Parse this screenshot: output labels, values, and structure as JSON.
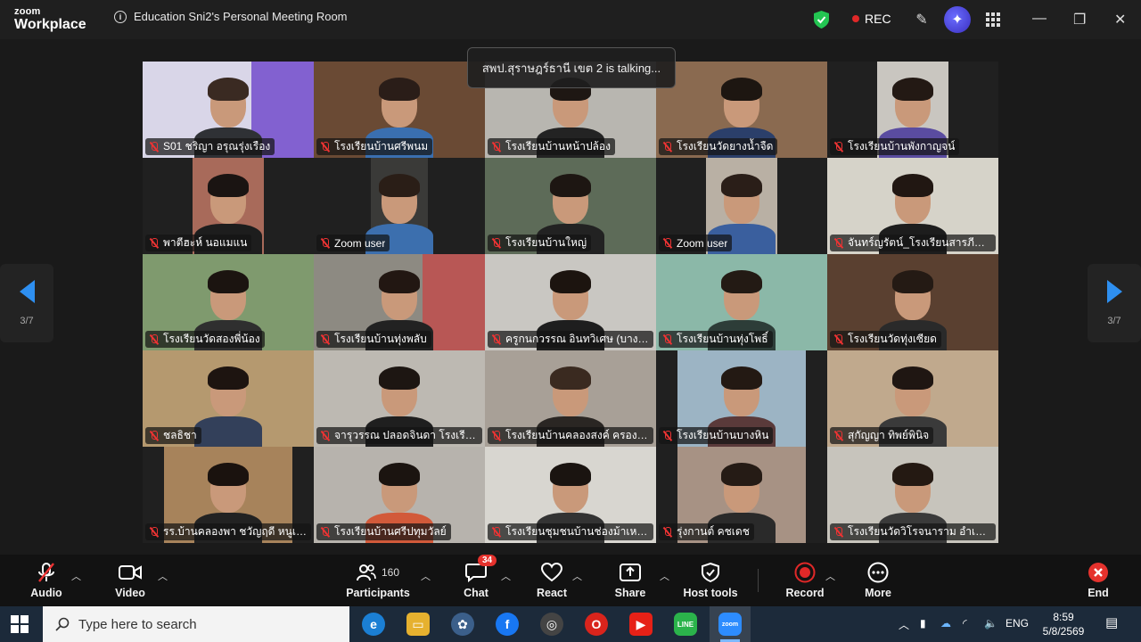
{
  "app": {
    "logo_top": "zoom",
    "logo_bottom": "Workplace",
    "meeting_title": "Education Sni2's Personal Meeting Room",
    "recording_label": "REC",
    "colors": {
      "accent": "#2e8ff0",
      "rec": "#e02828",
      "shield": "#23c552",
      "mute": "#e33333",
      "badge": "#e5322d"
    }
  },
  "gallery": {
    "talking_banner": "สพป.สุราษฎร์ธานี เขต 2 is talking...",
    "page_indicator_left": "3/7",
    "page_indicator_right": "3/7",
    "participants": [
      {
        "name": "S01 ชริญา อรุณรุ่งเรือง",
        "muted": true
      },
      {
        "name": "โรงเรียนบ้านศรีพนม",
        "muted": true
      },
      {
        "name": "โรงเรียนบ้านหน้าปล้อง",
        "muted": true
      },
      {
        "name": "โรงเรียนวัดยางน้ำจืด",
        "muted": true
      },
      {
        "name": "โรงเรียนบ้านพังกาญจน์",
        "muted": true
      },
      {
        "name": "พาตีฮะห์ นอแมแน",
        "muted": true
      },
      {
        "name": "Zoom user",
        "muted": true
      },
      {
        "name": "โรงเรียนบ้านใหญ่",
        "muted": true
      },
      {
        "name": "Zoom user",
        "muted": true
      },
      {
        "name": "จันทร์ญรัตน์_โรงเรียนสารภีอุทิศ",
        "muted": true
      },
      {
        "name": "โรงเรียนวัดสองพี่น้อง",
        "muted": true
      },
      {
        "name": "โรงเรียนบ้านทุ่งพลับ",
        "muted": true
      },
      {
        "name": "ครูกนกวรรณ อินทวิเศษ (บางขนุน)",
        "muted": true
      },
      {
        "name": "โรงเรียนบ้านทุ่งโพธิ์",
        "muted": true
      },
      {
        "name": "โรงเรียนวัดทุ่งเซียด",
        "muted": true
      },
      {
        "name": "ชลธิชา",
        "muted": true
      },
      {
        "name": "จารุวรรณ ปลอดจินดา โรงเรียนบ้า...",
        "muted": true
      },
      {
        "name": "โรงเรียนบ้านคลองสงค์ ครองศชนิดา",
        "muted": true
      },
      {
        "name": "โรงเรียนบ้านบางหิน",
        "muted": true
      },
      {
        "name": "สุกัญญา ทิพย์พินิจ",
        "muted": true
      },
      {
        "name": "รร.บ้านคลองพา ชวัญฤดี หนูเอียด",
        "muted": true
      },
      {
        "name": "โรงเรียนบ้านศรีปทุมวัลย์",
        "muted": true
      },
      {
        "name": "โรงเรียนชุมชนบ้านช่องม้าเหลียว",
        "muted": true
      },
      {
        "name": "รุ่งกานต์ คชเดช",
        "muted": true
      },
      {
        "name": "โรงเรียนวัดวิโรจนาราม อำเภอไชยา",
        "muted": true
      }
    ]
  },
  "toolbar": {
    "audio": "Audio",
    "video": "Video",
    "participants": "Participants",
    "participants_count": "160",
    "chat": "Chat",
    "chat_badge": "34",
    "react": "React",
    "share": "Share",
    "host_tools": "Host tools",
    "record": "Record",
    "more": "More",
    "end": "End"
  },
  "taskbar": {
    "search_placeholder": "Type here to search",
    "language": "ENG",
    "time": "8:59",
    "date": "5/8/2569"
  }
}
